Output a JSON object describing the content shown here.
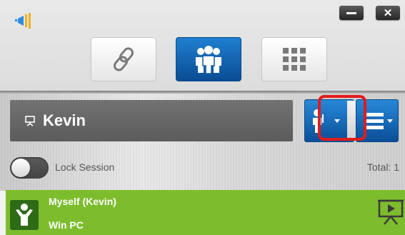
{
  "window": {
    "minimize_icon": "minimize-icon",
    "close_label": "✕"
  },
  "mode_tabs": [
    {
      "icon": "link-icon",
      "active": false
    },
    {
      "icon": "participants-icon",
      "active": true
    },
    {
      "icon": "grid-icon",
      "active": false
    }
  ],
  "presenter": {
    "name": "Kevin"
  },
  "lock_session": {
    "label": "Lock Session",
    "enabled": false
  },
  "total_label": "Total: 1",
  "participants": [
    {
      "name": "Myself (Kevin)",
      "os": "Win PC"
    }
  ],
  "colors": {
    "accent_blue": "#0b5fae",
    "participant_green": "#7dbd2d",
    "highlight_red": "#e11b1b"
  }
}
